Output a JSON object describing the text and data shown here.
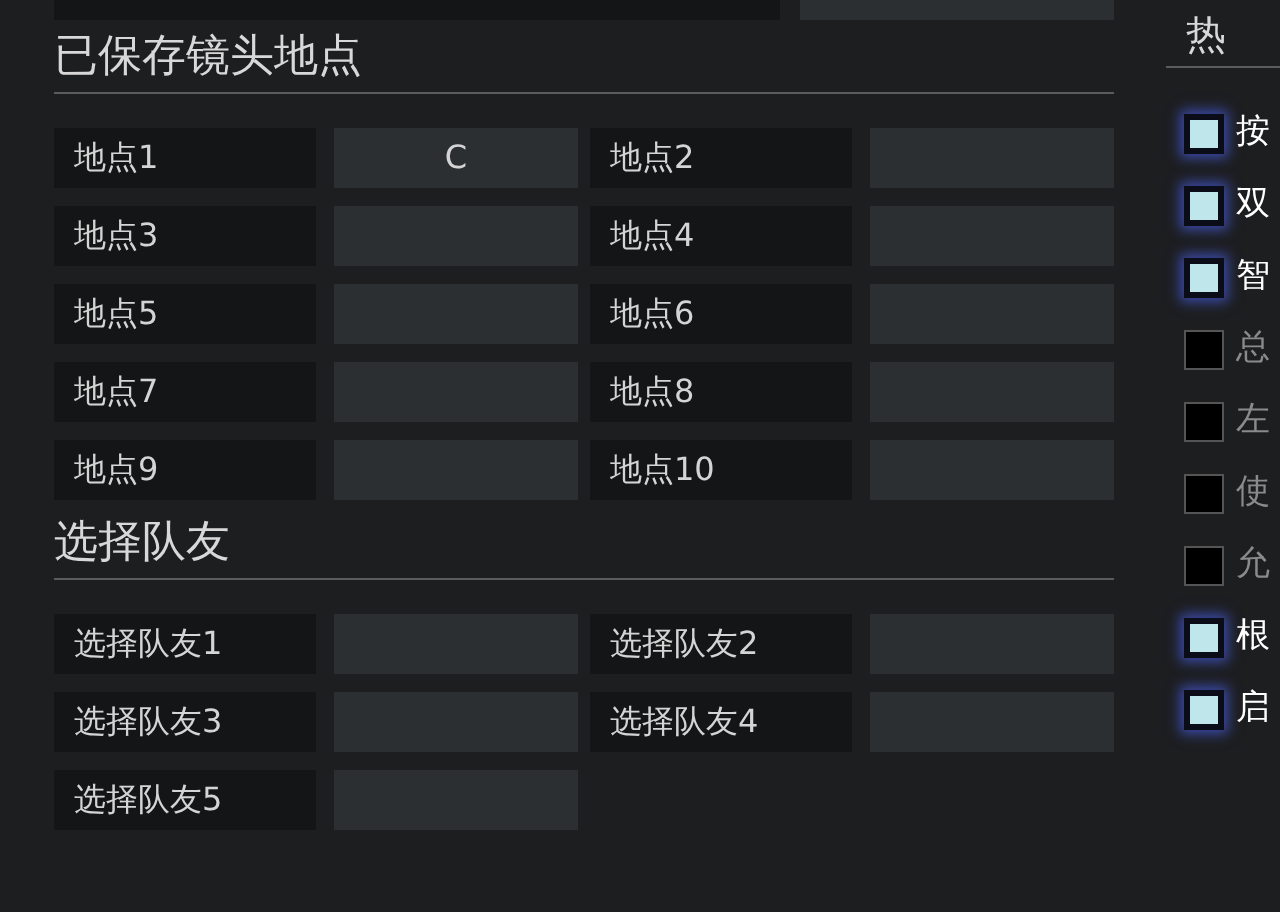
{
  "sections": [
    {
      "title": "已保存镜头地点",
      "bindings": [
        {
          "label": "地点1",
          "key": "C"
        },
        {
          "label": "地点2"
        },
        {
          "label": "地点3"
        },
        {
          "label": "地点4"
        },
        {
          "label": "地点5"
        },
        {
          "label": "地点6"
        },
        {
          "label": "地点7"
        },
        {
          "label": "地点8"
        },
        {
          "label": "地点9"
        },
        {
          "label": "地点10"
        }
      ]
    },
    {
      "title": "选择队友",
      "bindings": [
        {
          "label": "选择队友1"
        },
        {
          "label": "选择队友2"
        },
        {
          "label": "选择队友3"
        },
        {
          "label": "选择队友4"
        },
        {
          "label": "选择队友5"
        }
      ]
    }
  ],
  "hotkeys": {
    "title": "热",
    "options": [
      {
        "label": "按",
        "checked": true
      },
      {
        "label": "双",
        "checked": true
      },
      {
        "label": "智",
        "checked": true
      },
      {
        "label": "总",
        "checked": false
      },
      {
        "label": "左",
        "checked": false
      },
      {
        "label": "使",
        "checked": false
      },
      {
        "label": "允",
        "checked": false
      },
      {
        "label": "根",
        "checked": true
      },
      {
        "label": "启",
        "checked": true
      }
    ]
  }
}
